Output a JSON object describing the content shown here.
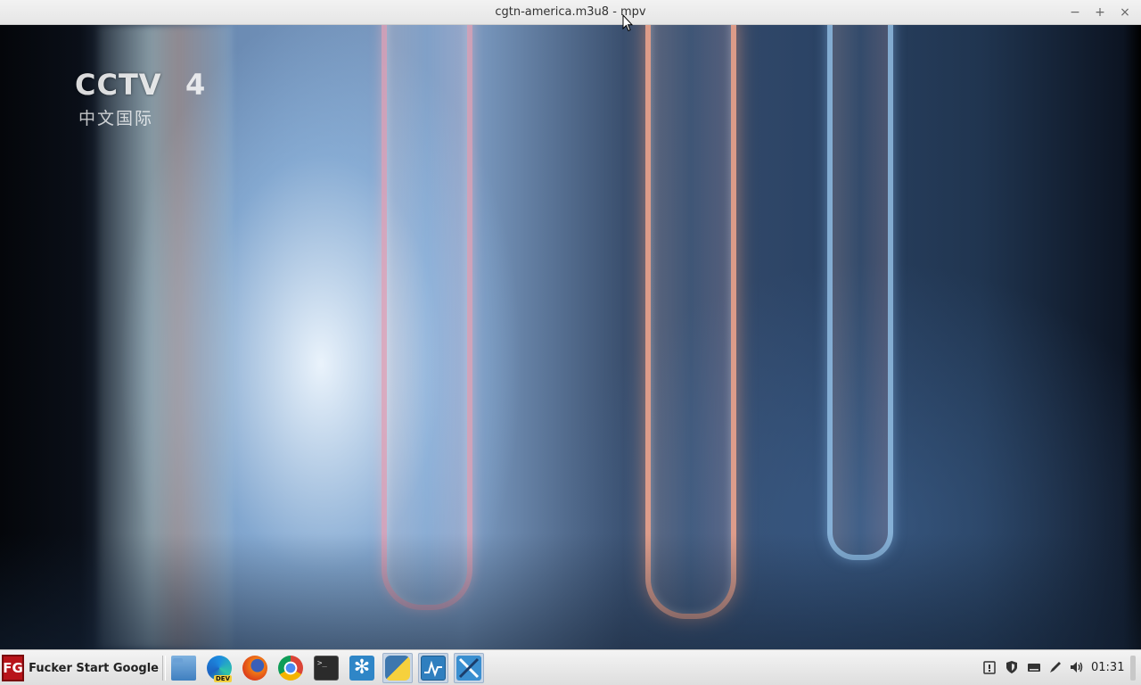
{
  "window": {
    "title": "cgtn-america.m3u8 - mpv",
    "controls": {
      "minimize": "−",
      "maximize": "+",
      "close": "×"
    }
  },
  "video": {
    "logo_main": "CCTV",
    "logo_number": "4",
    "logo_sub": "中文国际"
  },
  "taskbar": {
    "start_logo": "FG",
    "start_label": "Fucker Start Google",
    "launchers": [
      {
        "name": "file-manager-icon"
      },
      {
        "name": "edge-dev-icon",
        "badge": "DEV"
      },
      {
        "name": "firefox-icon"
      },
      {
        "name": "chrome-icon"
      },
      {
        "name": "terminal-icon",
        "glyph": ">_"
      },
      {
        "name": "snowflake-icon"
      },
      {
        "name": "python-icon"
      },
      {
        "name": "system-monitor-icon"
      },
      {
        "name": "tool-app-icon"
      }
    ],
    "tray": {
      "clock": "01:31"
    }
  }
}
